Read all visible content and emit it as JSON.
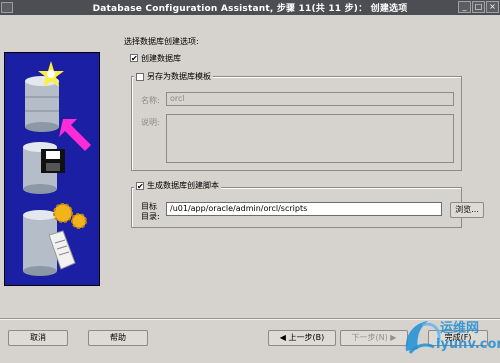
{
  "window": {
    "title": "Database Configuration Assistant, 步骤 11(共 11 步)： 创建选项",
    "controls": [
      "minimize-icon",
      "maximize-icon",
      "close-icon"
    ]
  },
  "main": {
    "heading": "选择数据库创建选项:",
    "create_db": {
      "label": "创建数据库",
      "checked": true
    },
    "template_group": {
      "legend": "另存为数据库模板",
      "checked": false,
      "name_label": "名称:",
      "name_value": "orcl",
      "desc_label": "说明:",
      "desc_value": ""
    },
    "script_group": {
      "legend": "生成数据库创建脚本",
      "checked": true,
      "dir_label_1": "目标",
      "dir_label_2": "目录:",
      "dir_value": "/u01/app/oracle/admin/orcl/scripts",
      "browse_label": "浏览..."
    }
  },
  "footer": {
    "cancel": "取消",
    "help": "帮助",
    "back": "上一步(B)",
    "next": "下一步(N)",
    "finish": "完成(F)"
  },
  "watermark": {
    "brand": "运维网",
    "site": "iyunv.com"
  },
  "colors": {
    "titlebar": "#4d4e54",
    "background": "#d6d3ce",
    "art_bg": "#1b1fa3",
    "watermark": "#1f8fd6"
  }
}
